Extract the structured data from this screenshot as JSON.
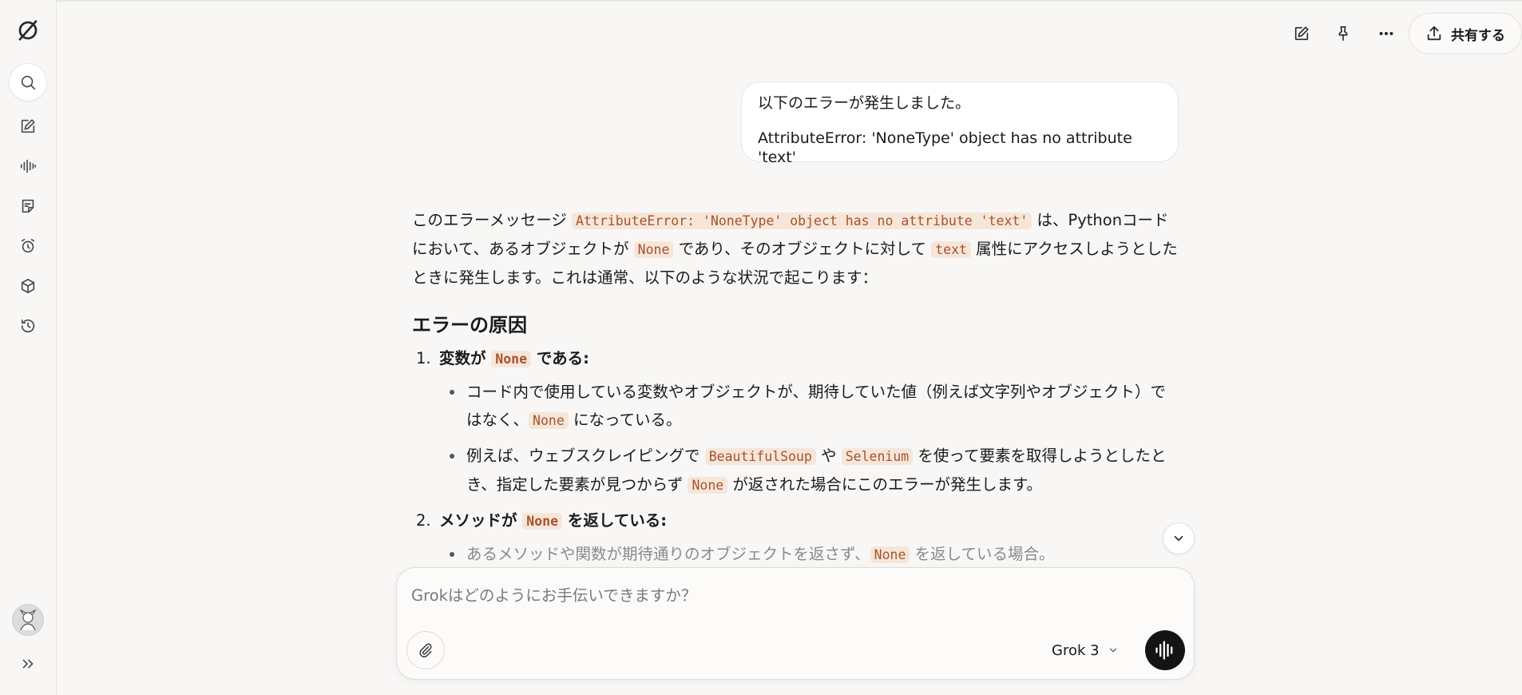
{
  "header": {
    "share_label": "共有する"
  },
  "conversation": {
    "user_message": {
      "line1": "以下のエラーが発生しました。",
      "line2": "AttributeError: 'NoneType' object has no attribute 'text'"
    },
    "answer": {
      "intro": {
        "t1": "このエラーメッセージ ",
        "c1": "AttributeError: 'NoneType' object has no attribute 'text'",
        "t2": " は、Pythonコードにおいて、あるオブジェクトが ",
        "c2": "None",
        "t3": " であり、そのオブジェクトに対して ",
        "c3": "text",
        "t4": " 属性にアクセスしようとしたときに発生します。これは通常、以下のような状況で起こります："
      },
      "heading": "エラーの原因",
      "items": [
        {
          "num": "1.",
          "title_a": "変数が ",
          "title_code": "None",
          "title_b": " である:",
          "bullets": [
            {
              "t1": "コード内で使用している変数やオブジェクトが、期待していた値（例えば文字列やオブジェクト）ではなく、",
              "c1": "None",
              "t2": " になっている。"
            },
            {
              "t1": "例えば、ウェブスクレイピングで ",
              "c1": "BeautifulSoup",
              "t2": " や ",
              "c2": "Selenium",
              "t3": " を使って要素を取得しようとしたとき、指定した要素が見つからず ",
              "c3": "None",
              "t4": " が返された場合にこのエラーが発生します。"
            }
          ]
        },
        {
          "num": "2.",
          "title_a": "メソッドが ",
          "title_code": "None",
          "title_b": " を返している:",
          "bullets": [
            {
              "t1": "あるメソッドや関数が期待通りのオブジェクトを返さず、",
              "c1": "None",
              "t2": " を返している場合。"
            }
          ]
        }
      ]
    }
  },
  "composer": {
    "placeholder": "Grokはどのようにお手伝いできますか？",
    "model_label": "Grok 3"
  },
  "icons": {
    "logo": "grok-logo-icon",
    "search": "search-icon",
    "new_chat": "edit-icon",
    "voice": "voice-waveform-icon",
    "tasks": "notes-icon",
    "schedule": "alarm-icon",
    "projects": "cube-icon",
    "history": "history-icon",
    "expand": "double-chevron-right-icon",
    "pin": "pin-icon",
    "more": "more-horizontal-icon",
    "share": "upload-icon",
    "attach": "paperclip-icon",
    "scroll_down": "chevron-down-icon"
  }
}
